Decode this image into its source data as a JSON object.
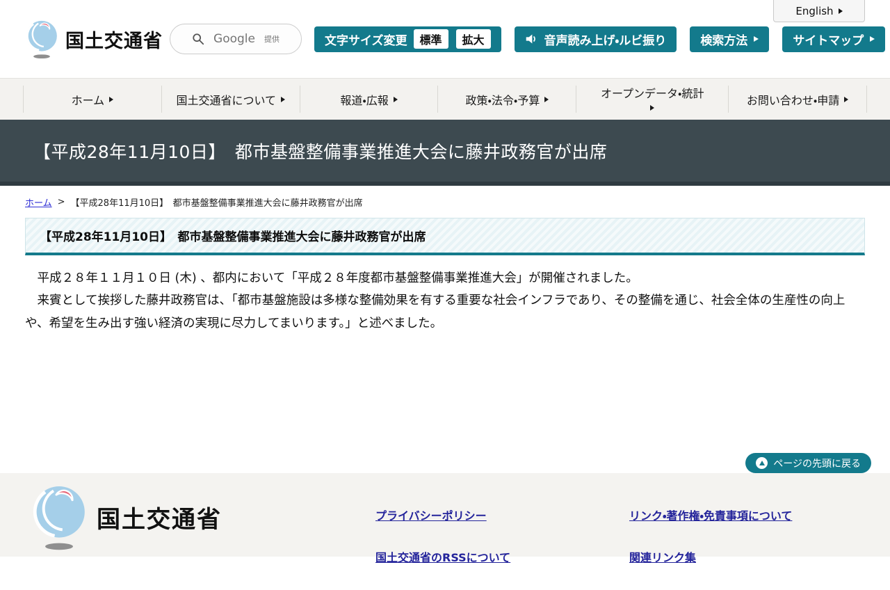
{
  "header": {
    "logo_text": "国土交通省",
    "english_label": "English",
    "search": {
      "brand": "Google",
      "provided": "提供"
    },
    "font_size_label": "文字サイズ変更",
    "font_size_options": [
      "標準",
      "拡大"
    ],
    "audio_label": "音声読み上げ・ルビ振り",
    "search_method_label": "検索方法",
    "sitemap_label": "サイトマップ"
  },
  "nav": {
    "items": [
      {
        "label": "ホーム"
      },
      {
        "label": "国土交通省について"
      },
      {
        "label": "報道・広報"
      },
      {
        "label": "政策・法令・予算"
      },
      {
        "label": "オープンデータ・統計"
      },
      {
        "label": "お問い合わせ・申請"
      }
    ]
  },
  "banner": {
    "title": "【平成28年11月10日】　都市基盤整備事業推進大会に藤井政務官が出席"
  },
  "breadcrumb": {
    "home": "ホーム",
    "separator": ">",
    "current": "【平成28年11月10日】　都市基盤整備事業推進大会に藤井政務官が出席"
  },
  "article": {
    "heading": "【平成28年11月10日】　都市基盤整備事業推進大会に藤井政務官が出席",
    "paragraphs": [
      "　平成２８年１１月１０日 (木) 、都内において「平成２８年度都市基盤整備事業推進大会」が開催されました。",
      "　来賓として挨拶した藤井政務官は、「都市基盤施設は多様な整備効果を有する重要な社会インフラであり、その整備を通じ、社会全体の生産性の向上や、希望を生み出す強い経済の実現に尽力してまいります。」と述べました。"
    ]
  },
  "back_to_top": {
    "label": "ページの先頭に戻る"
  },
  "footer": {
    "logo_text": "国土交通省",
    "columns": [
      {
        "links": [
          "プライバシーポリシー",
          "国土交通省のRSSについて"
        ]
      },
      {
        "links": [
          "リンク・著作権・免責事項について",
          "関連リンク集"
        ]
      }
    ]
  },
  "colors": {
    "teal": "#137a8c",
    "banner_bg": "#3d4a50",
    "breadcrumb_link": "#2b2bd4",
    "footer_link": "#24249b",
    "logo_blue": "#a5cfe9",
    "logo_red": "#e8697a"
  }
}
